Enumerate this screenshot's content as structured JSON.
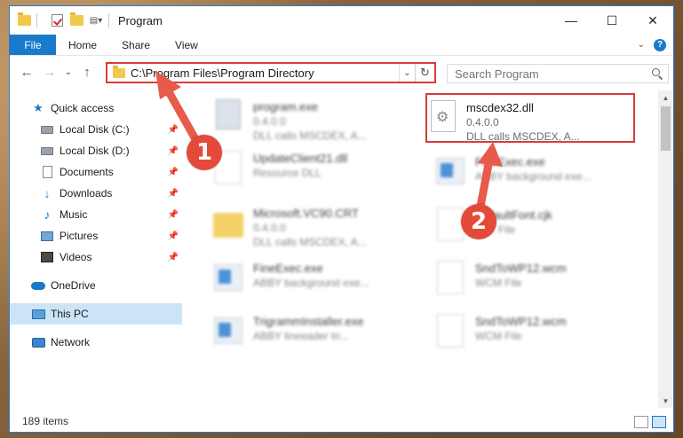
{
  "window": {
    "title": "Program",
    "minimize_glyph": "—",
    "maximize_glyph": "☐",
    "close_glyph": "✕"
  },
  "ribbon": {
    "file": "File",
    "tabs": [
      "Home",
      "Share",
      "View"
    ],
    "help_glyph": "?"
  },
  "address": {
    "path": "C:\\Program Files\\Program Directory",
    "refresh_glyph": "↻",
    "dropdown_glyph": "⌄"
  },
  "search": {
    "placeholder": "Search Program"
  },
  "nav": {
    "back_glyph": "←",
    "forward_glyph": "→",
    "recent_glyph": "⌄",
    "up_glyph": "↑"
  },
  "sidebar": {
    "quick_access": "Quick access",
    "items": [
      {
        "label": "Local Disk (C:)",
        "icon": "disk-icon"
      },
      {
        "label": "Local Disk (D:)",
        "icon": "disk-icon"
      },
      {
        "label": "Documents",
        "icon": "documents-icon"
      },
      {
        "label": "Downloads",
        "icon": "downloads-icon"
      },
      {
        "label": "Music",
        "icon": "music-icon"
      },
      {
        "label": "Pictures",
        "icon": "pictures-icon"
      },
      {
        "label": "Videos",
        "icon": "videos-icon"
      }
    ],
    "onedrive": "OneDrive",
    "this_pc": "This PC",
    "network": "Network"
  },
  "files": [
    {
      "name": "program.exe",
      "sub1": "0.4.0.0",
      "sub2": "DLL calls MSCDEX, A..."
    },
    {
      "name": "UpdateClient21.dll",
      "sub1": "Resource DLL",
      "sub2": ""
    },
    {
      "name": "Microsoft.VC90.CRT",
      "sub1": "0.4.0.0",
      "sub2": "DLL calls MSCDEX, A..."
    },
    {
      "name": "FineExec.exe",
      "sub1": "ABBY background exe...",
      "sub2": ""
    },
    {
      "name": "TrigrammInstaller.exe",
      "sub1": "ABBY lineeader tri...",
      "sub2": ""
    },
    {
      "name": "FineExec.exe",
      "sub1": "ABBY background exe...",
      "sub2": ""
    },
    {
      "name": "DefaultFont.cjk",
      "sub1": "CJK File",
      "sub2": ""
    },
    {
      "name": "SndToWP12.wcm",
      "sub1": "WCM File",
      "sub2": ""
    },
    {
      "name": "SndToWP12.wcm",
      "sub1": "WCM File",
      "sub2": ""
    }
  ],
  "highlight_file": {
    "name": "mscdex32.dll",
    "version": "0.4.0.0",
    "description": "DLL calls MSCDEX, A..."
  },
  "status": {
    "count": "189 items"
  },
  "annotations": {
    "step1": "1",
    "step2": "2",
    "color": "#e44a3a"
  },
  "colors": {
    "accent": "#1979ca",
    "highlight_border": "#d63b3b",
    "selected_bg": "#cce4f7"
  }
}
